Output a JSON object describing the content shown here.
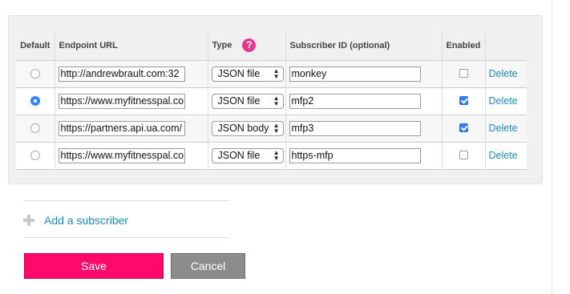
{
  "table": {
    "headers": {
      "default": "Default",
      "endpoint_url": "Endpoint URL",
      "type": "Type",
      "subscriber_id": "Subscriber ID (optional)",
      "enabled": "Enabled",
      "actions": ""
    },
    "type_help_icon": "?",
    "rows": [
      {
        "is_default": false,
        "endpoint_url": "http://andrewbrault.com:32",
        "type": "JSON file",
        "subscriber_id": "monkey",
        "enabled": false,
        "delete_label": "Delete"
      },
      {
        "is_default": true,
        "endpoint_url": "https://www.myfitnesspal.co",
        "type": "JSON file",
        "subscriber_id": "mfp2",
        "enabled": true,
        "delete_label": "Delete"
      },
      {
        "is_default": false,
        "endpoint_url": "https://partners.api.ua.com/",
        "type": "JSON body",
        "subscriber_id": "mfp3",
        "enabled": true,
        "delete_label": "Delete"
      },
      {
        "is_default": false,
        "endpoint_url": "https://www.myfitnesspal.co",
        "type": "JSON file",
        "subscriber_id": "https-mfp",
        "enabled": false,
        "delete_label": "Delete"
      }
    ]
  },
  "add_subscriber": {
    "label": "Add a subscriber",
    "icon": "plus-icon"
  },
  "buttons": {
    "save_label": "Save",
    "cancel_label": "Cancel"
  },
  "colors": {
    "accent": "#ff0a6c",
    "link": "#1a8cbf",
    "help_icon": "#e13a8f",
    "cancel": "#8c8c8c",
    "radio_selected": "#3a86ff"
  }
}
